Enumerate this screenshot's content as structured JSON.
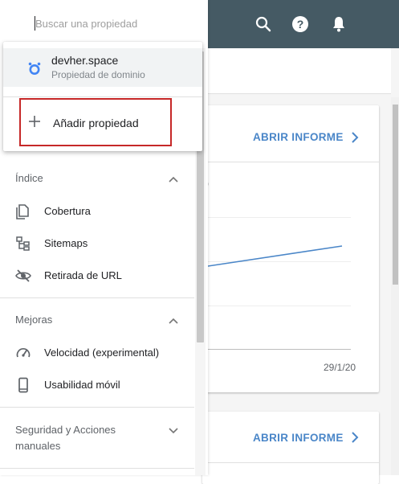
{
  "search": {
    "placeholder": "Buscar una propiedad"
  },
  "appbar": {
    "icons": [
      "search-icon",
      "help-icon",
      "notifications-icon"
    ],
    "help_glyph": "?",
    "bg_color": "#455a64"
  },
  "property_dropdown": {
    "selected": {
      "name": "devher.space",
      "type": "Propiedad de dominio"
    },
    "add_label": "Añadir propiedad",
    "highlight_color": "#c62828"
  },
  "nav": {
    "sections": [
      {
        "title": "Índice",
        "expanded": true,
        "items": [
          {
            "label": "Cobertura",
            "icon": "coverage-icon"
          },
          {
            "label": "Sitemaps",
            "icon": "sitemap-icon"
          },
          {
            "label": "Retirada de URL",
            "icon": "visibility-off-icon"
          }
        ]
      },
      {
        "title": "Mejoras",
        "expanded": true,
        "items": [
          {
            "label": "Velocidad (experimental)",
            "icon": "speed-gauge-icon"
          },
          {
            "label": "Usabilidad móvil",
            "icon": "smartphone-icon"
          }
        ]
      },
      {
        "title": "Seguridad y Acciones manuales",
        "expanded": false,
        "items": []
      }
    ]
  },
  "main": {
    "cards": [
      {
        "action_label": "ABRIR INFORME",
        "legend_fragment": ")",
        "x_label": "29/1/20"
      },
      {
        "action_label": "ABRIR INFORME"
      }
    ],
    "accent_color": "#4a86c8"
  }
}
